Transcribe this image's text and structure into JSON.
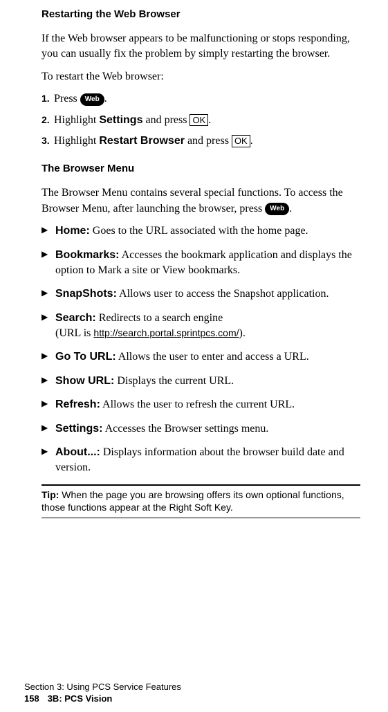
{
  "heading1": "Restarting the Web Browser",
  "para1": "If the Web browser appears to be malfunctioning or stops responding, you can usually fix the problem by simply restarting the browser.",
  "para2": "To restart the Web browser:",
  "steps": {
    "s1": {
      "num": "1.",
      "pre": "Press ",
      "web": "Web",
      "post": "."
    },
    "s2": {
      "num": "2.",
      "pre": "Highlight ",
      "bold": "Settings",
      "mid": " and press ",
      "ok": "OK",
      "post": "."
    },
    "s3": {
      "num": "3.",
      "pre": "Highlight ",
      "bold": "Restart Browser",
      "mid": " and press ",
      "ok": "OK",
      "post": "."
    }
  },
  "heading2": "The Browser Menu",
  "para3a": "The Browser Menu contains several special functions. To access the Browser Menu, after launching the browser, press ",
  "para3web": "Web",
  "para3b": ".",
  "bullets": {
    "b1": {
      "label": "Home:",
      "text": " Goes to the URL associated with the home page."
    },
    "b2": {
      "label": "Bookmarks:",
      "text": " Accesses the bookmark application and displays the option to Mark a site or View bookmarks."
    },
    "b3": {
      "label": "SnapShots:",
      "text": " Allows user to access the Snapshot application."
    },
    "b4": {
      "label": "Search:",
      "text_a": " Redirects to a search engine",
      "text_b": "(URL is ",
      "url": "http://search.portal.sprintpcs.com/",
      "text_c": ")."
    },
    "b5": {
      "label": "Go To URL:",
      "text": " Allows the user to enter and access a URL."
    },
    "b6": {
      "label": "Show URL:",
      "text": " Displays the current URL."
    },
    "b7": {
      "label": "Refresh:",
      "text": " Allows the user to refresh the current URL."
    },
    "b8": {
      "label": "Settings:",
      "text": " Accesses the Browser settings menu."
    },
    "b9": {
      "label": "About...:",
      "text": " Displays information about the browser build date and version."
    }
  },
  "tip": {
    "label": "Tip:",
    "text": " When the page you are browsing offers its own optional functions, those functions appear at the Right Soft Key."
  },
  "footer": {
    "line1": "Section 3: Using PCS Service Features",
    "page": "158",
    "line2": "3B: PCS Vision"
  },
  "marker": "▶"
}
